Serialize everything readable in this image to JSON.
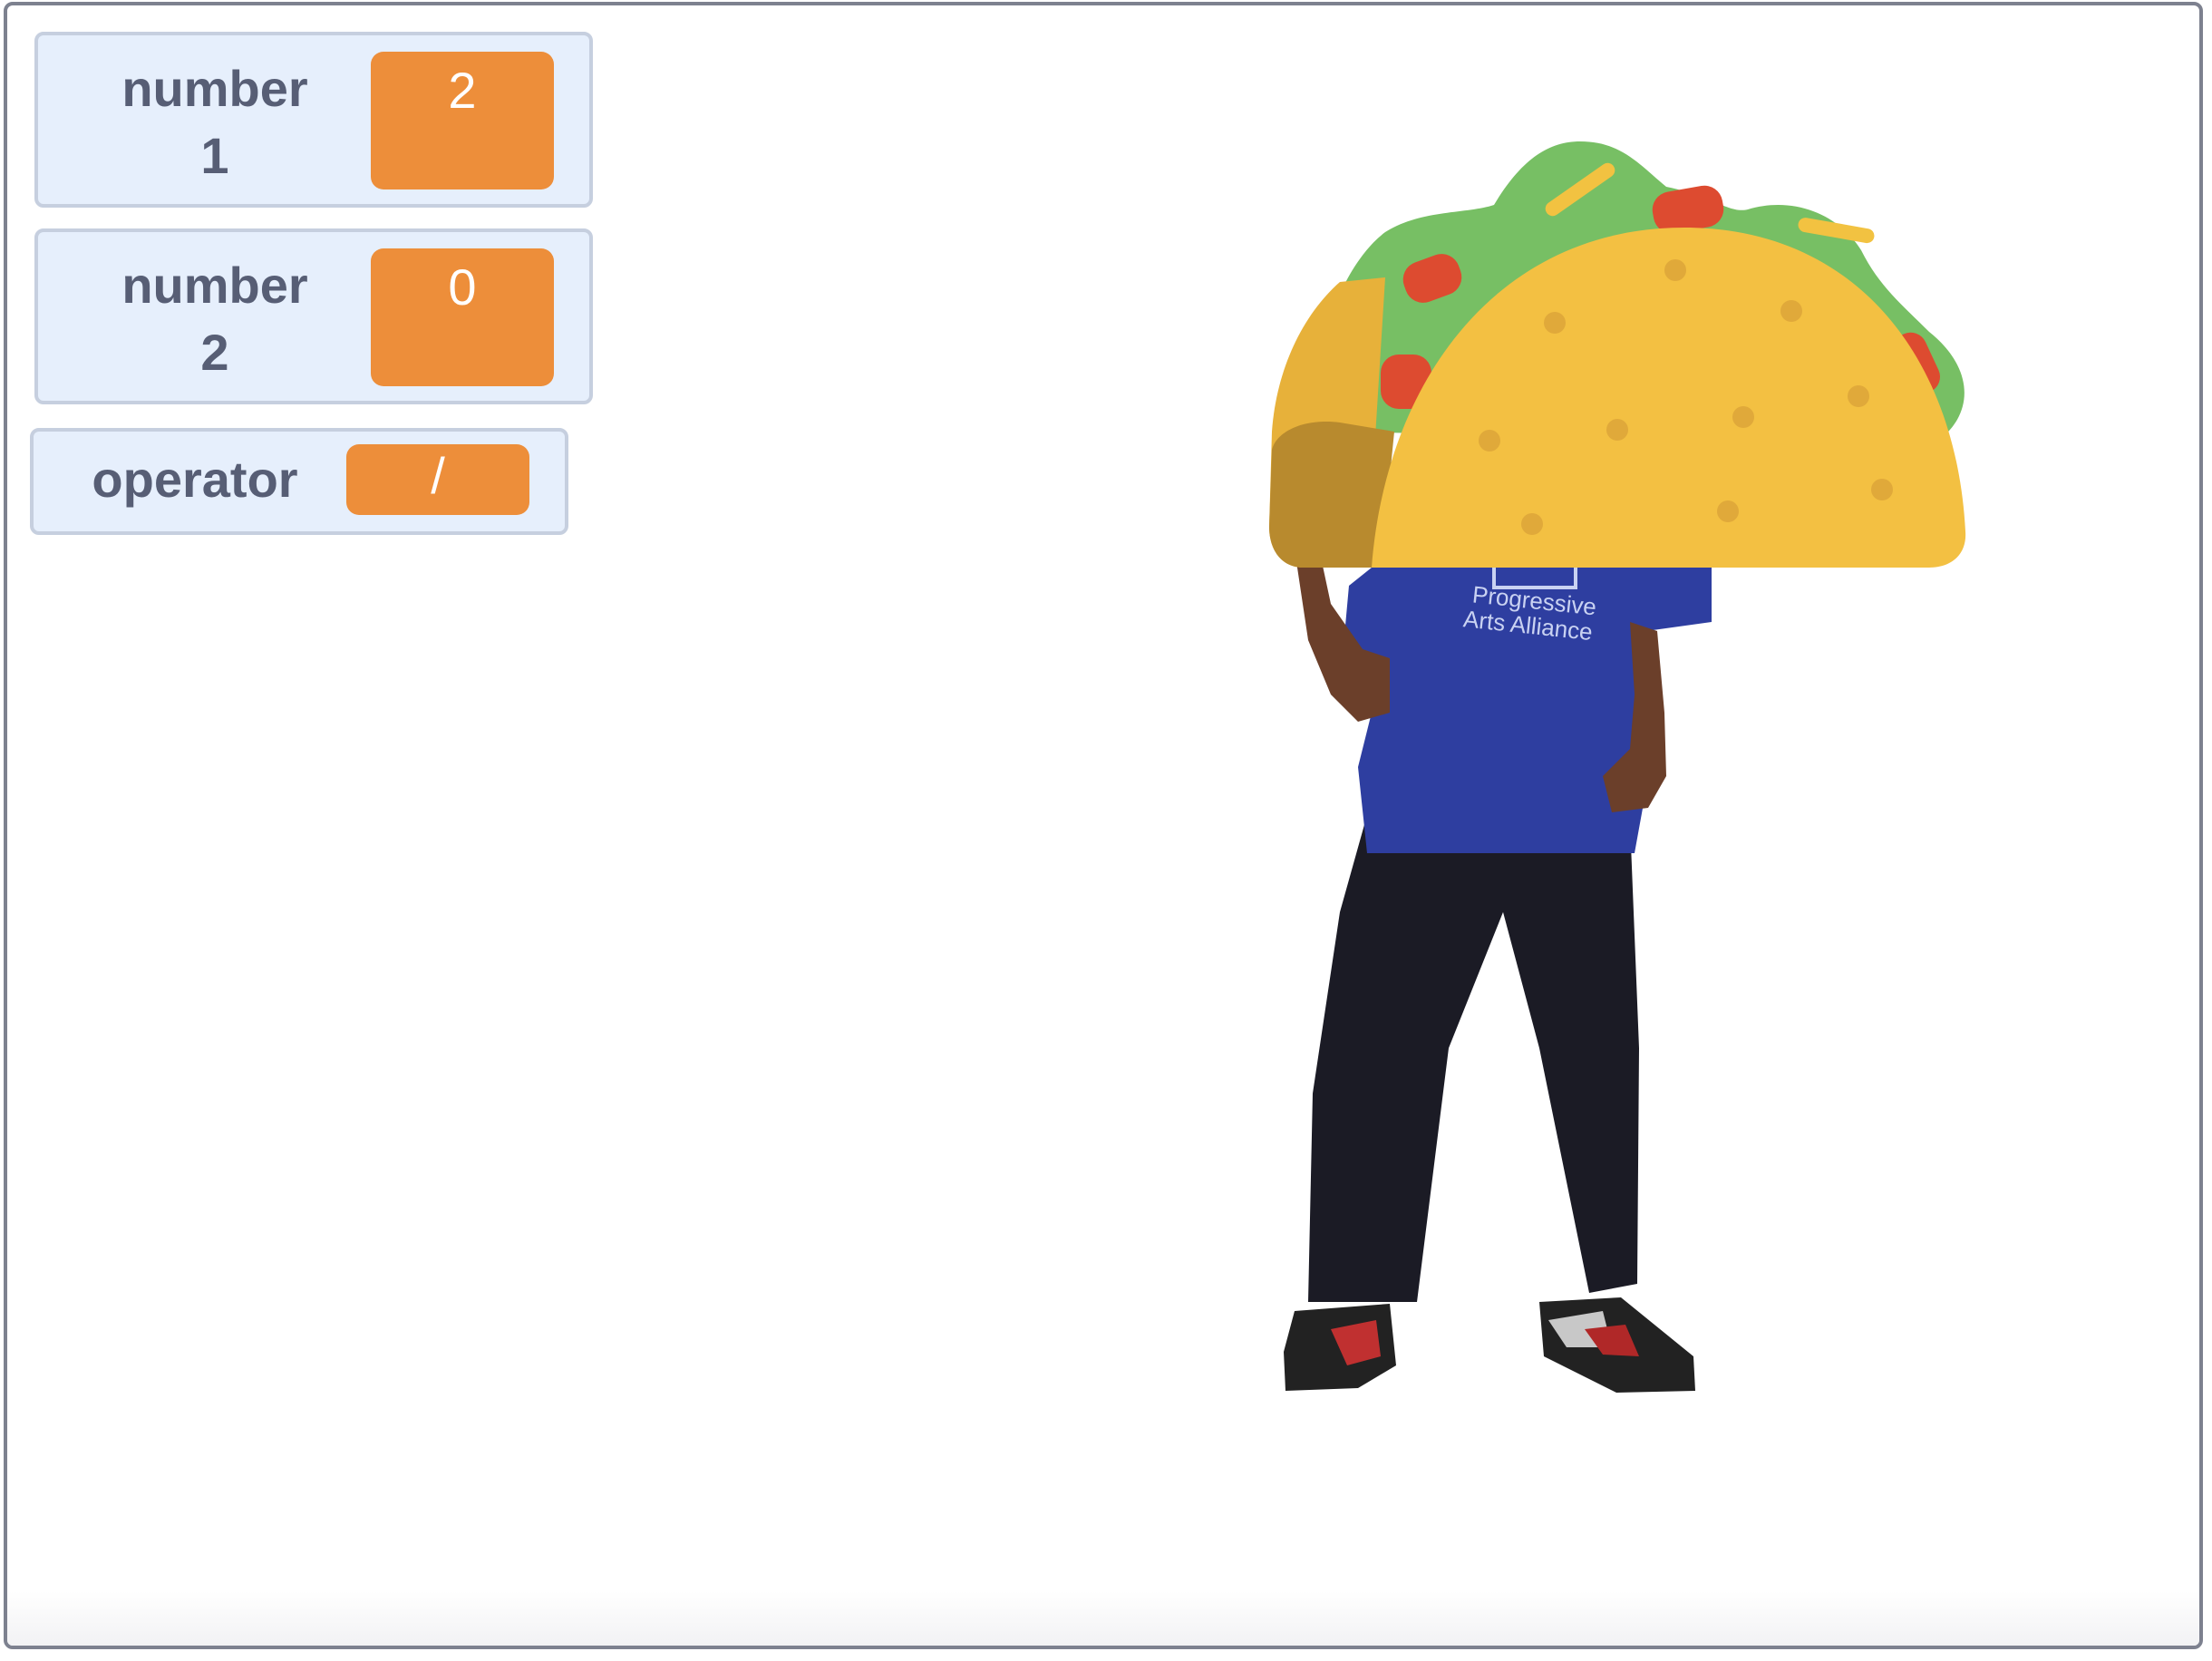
{
  "monitors": {
    "number1": {
      "label_line1": "number",
      "label_line2": "1",
      "value": "2"
    },
    "number2": {
      "label_line1": "number",
      "label_line2": "2",
      "value": "0"
    },
    "operator": {
      "label": "operator",
      "value": "/"
    }
  },
  "sprites": {
    "person": {
      "shirt_text_line1": "Progressive",
      "shirt_text_line2": "Arts Alliance"
    },
    "taco": {}
  },
  "colors": {
    "monitor_bg": "#e6effc",
    "monitor_value": "#ed8e3a",
    "monitor_label": "#575e75",
    "stage_border": "#7d818f"
  }
}
